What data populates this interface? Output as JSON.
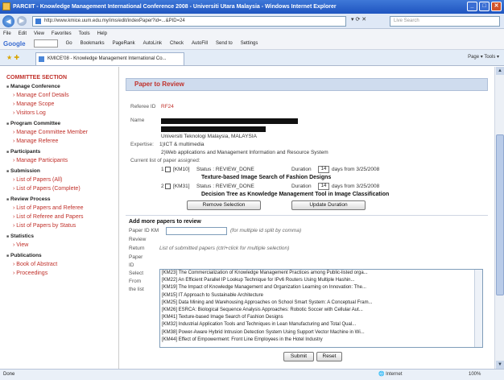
{
  "window": {
    "title": "PARCIIT - Knowledge Management International Conference 2008 - Universiti Utara Malaysia - Windows Internet Explorer",
    "buttons": [
      "_",
      "□",
      "✕"
    ]
  },
  "address": {
    "url": "http://www.kmice.uum.edu.my/ims/edit/indexPaper?id=...&PID=24",
    "search_placeholder": "Live Search"
  },
  "menu": [
    "File",
    "Edit",
    "View",
    "Favorites",
    "Tools",
    "Help"
  ],
  "google_bar": {
    "logo": "Google",
    "items": [
      "Go",
      "Bookmarks",
      "PageRank",
      "AutoLink",
      "Check",
      "AutoFill",
      "Send to",
      "Settings"
    ]
  },
  "tab": {
    "title": "KMICE'08 - Knowledge Management International Co...",
    "commands": "Page ▾  Tools ▾"
  },
  "sidebar": {
    "heading": "COMMITTEE SECTION",
    "sections": [
      {
        "title": "Manage Conference",
        "links": [
          "Manage Conf Details",
          "Manage Scope",
          "Visitors Log"
        ]
      },
      {
        "title": "Program Committee",
        "links": [
          "Manage Committee Member",
          "Manage Referee"
        ]
      },
      {
        "title": "Participants",
        "links": [
          "Manage Participants"
        ]
      },
      {
        "title": "Submission",
        "links": [
          "List of Papers (All)",
          "List of Papers (Complete)"
        ]
      },
      {
        "title": "Review Process",
        "links": [
          "List of Papers and Referee",
          "List of Referee and Papers",
          "List of Papers by Status"
        ]
      },
      {
        "title": "Statistics",
        "links": [
          "View"
        ]
      },
      {
        "title": "Publications",
        "links": [
          "Book of Abstract",
          "Proceedings"
        ]
      }
    ]
  },
  "panel": {
    "title": "Paper to Review",
    "referee_id_label": "Referee ID",
    "referee_id_value": "RF24",
    "name_label": "Name",
    "affiliation": "Universiti Teknologi Malaysia, MALAYSIA",
    "expertise_label": "Expertise:",
    "expertise_1": "1)ICT & multimedia",
    "expertise_2": "2)Web applications and Management Information and Resource System",
    "current_list_label": "Current list of paper assigned:",
    "assigned": [
      {
        "index": "1",
        "paper_id": "[KM10]",
        "status": "Status : REVIEW_DONE",
        "duration_label": "Duration",
        "duration": "14",
        "days_from": "days from 3/25/2008",
        "title": "Texture-based Image Search of Fashion Designs"
      },
      {
        "index": "2",
        "paper_id": "[KM31]",
        "status": "Status : REVIEW_DONE",
        "duration_label": "Duration",
        "duration": "14",
        "days_from": "days from 3/25/2008",
        "title": "Decision Tree as Knowledge Management Tool in Image Classification"
      }
    ],
    "remove_button": "Remove Selection",
    "update_button": "Update Duration"
  },
  "add_section": {
    "heading": "Add more papers to review",
    "paper_id_label": "Paper ID  KM",
    "paper_id_hint": "(for multiple id split by comma)",
    "review_label": "Review",
    "return_label": "Return",
    "list_hint": "List of submitted papers (ctrl+click for multiple selection)",
    "left_labels": [
      "Paper",
      "ID",
      "Select",
      "From",
      "the list"
    ],
    "papers": [
      "[KM23] The Commercialization of Knowledge Management Practices among Public-listed orga...",
      "[KM22] An Efficient Parallel IP Lookup Technique for IPv6 Routers Using Multiple Hashin...",
      "[KM19] The Impact of Knowledge Management and Organization Learning on Innovation: The...",
      "[KM15] IT Approach to Sustainable Architecture",
      "[KM25] Data Mining and Warehousing Approaches on School Smart System: A Conceptual Fram...",
      "[KM26] ESRCA: Biological Sequence Analysis Approaches: Robotic Soccer with Cellular Aut...",
      "[KM41] Texture-based Image Search of Fashion Designs",
      "[KM32] Industrial Application Tools and Techniques in Lean Manufacturing and Total Qual...",
      "[KM38] Power-Aware Hybrid Intrusion Detection System Using Support Vector Machine in Wi...",
      "[KM44] Effect of Empowerment: Front Line Employees in the Hotel Industry"
    ],
    "submit_button": "Submit",
    "reset_button": "Reset"
  },
  "status": {
    "left": "Done",
    "zone": "Internet",
    "zoom": "100%"
  }
}
